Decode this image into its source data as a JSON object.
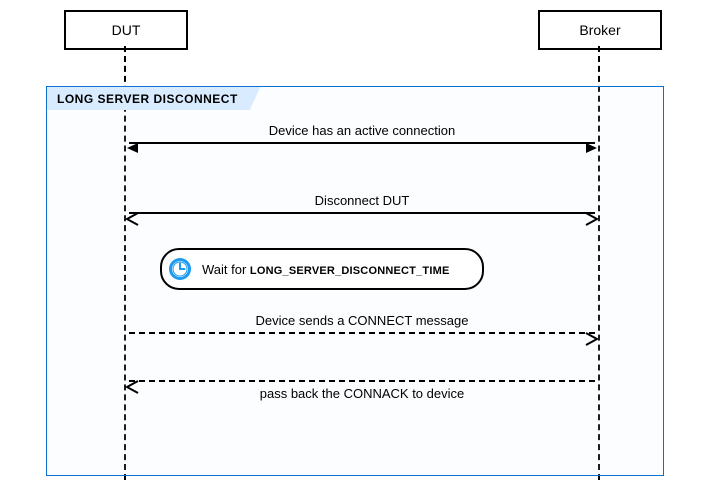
{
  "participants": {
    "left": {
      "name": "DUT"
    },
    "right": {
      "name": "Broker"
    }
  },
  "frame": {
    "title": "LONG SERVER DISCONNECT"
  },
  "messages": {
    "m1": {
      "label": "Device has an active connection"
    },
    "m2": {
      "label": "Disconnect DUT"
    },
    "m3": {
      "label": "Device sends a CONNECT message"
    },
    "m4": {
      "label": "pass back the CONNACK to device"
    }
  },
  "wait": {
    "prefix": "Wait for ",
    "constant": "LONG_SERVER_DISCONNECT_TIME"
  },
  "chart_data": {
    "type": "sequence-diagram",
    "participants": [
      "DUT",
      "Broker"
    ],
    "fragment": {
      "kind": "group",
      "label": "LONG SERVER DISCONNECT"
    },
    "steps": [
      {
        "type": "message",
        "from": "DUT",
        "to": "Broker",
        "text": "Device has an active connection",
        "line": "solid",
        "arrows": "both",
        "style": "filled"
      },
      {
        "type": "message",
        "from": "Broker",
        "to": "DUT",
        "text": "Disconnect DUT",
        "line": "solid",
        "arrows": "both",
        "style": "open"
      },
      {
        "type": "wait",
        "at": "DUT",
        "text": "Wait for LONG_SERVER_DISCONNECT_TIME"
      },
      {
        "type": "message",
        "from": "DUT",
        "to": "Broker",
        "text": "Device sends a CONNECT message",
        "line": "dashed",
        "arrows": "to",
        "style": "open"
      },
      {
        "type": "message",
        "from": "Broker",
        "to": "DUT",
        "text": "pass back the CONNACK to device",
        "line": "dashed",
        "arrows": "to",
        "style": "open"
      }
    ]
  }
}
